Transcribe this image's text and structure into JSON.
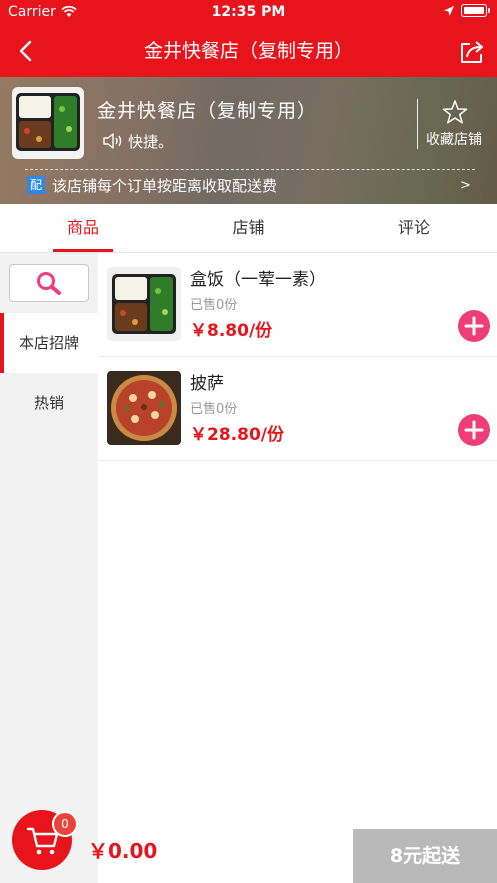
{
  "status_bar": {
    "carrier": "Carrier",
    "time": "12:35 PM"
  },
  "nav": {
    "title": "金井快餐店（复制专用）",
    "back_icon": "chevron-left-icon",
    "share_icon": "share-icon"
  },
  "store": {
    "name": "金井快餐店（复制专用）",
    "slogan": "快捷。",
    "favorite_label": "收藏店铺",
    "delivery_tag": "配",
    "delivery_note": "该店铺每个订单按距离收取配送费",
    "more_arrow": ">"
  },
  "tabs": [
    {
      "label": "商品",
      "active": true
    },
    {
      "label": "店铺",
      "active": false
    },
    {
      "label": "评论",
      "active": false
    }
  ],
  "categories": [
    {
      "label": "本店招牌",
      "active": true
    },
    {
      "label": "热销",
      "active": false
    }
  ],
  "products": [
    {
      "name": "盒饭（一荤一素）",
      "sold": "已售0份",
      "price": "￥8.80/份",
      "image": "bento-box"
    },
    {
      "name": "披萨",
      "sold": "已售0份",
      "price": "￥28.80/份",
      "image": "pizza"
    }
  ],
  "cart": {
    "count": "0",
    "total": "￥0.00",
    "checkout_label": "8元起送"
  },
  "colors": {
    "primary": "#e8141c",
    "add_button": "#ef3d7a",
    "checkout_bg": "#b9b9b9"
  }
}
